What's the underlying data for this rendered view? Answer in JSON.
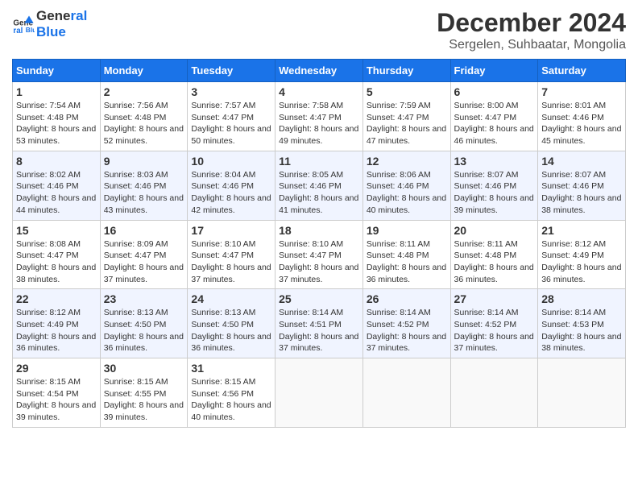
{
  "logo": {
    "line1": "General",
    "line2": "Blue"
  },
  "title": "December 2024",
  "subtitle": "Sergelen, Suhbaatar, Mongolia",
  "headers": [
    "Sunday",
    "Monday",
    "Tuesday",
    "Wednesday",
    "Thursday",
    "Friday",
    "Saturday"
  ],
  "weeks": [
    [
      {
        "day": "1",
        "sunrise": "7:54 AM",
        "sunset": "4:48 PM",
        "daylight": "8 hours and 53 minutes."
      },
      {
        "day": "2",
        "sunrise": "7:56 AM",
        "sunset": "4:48 PM",
        "daylight": "8 hours and 52 minutes."
      },
      {
        "day": "3",
        "sunrise": "7:57 AM",
        "sunset": "4:47 PM",
        "daylight": "8 hours and 50 minutes."
      },
      {
        "day": "4",
        "sunrise": "7:58 AM",
        "sunset": "4:47 PM",
        "daylight": "8 hours and 49 minutes."
      },
      {
        "day": "5",
        "sunrise": "7:59 AM",
        "sunset": "4:47 PM",
        "daylight": "8 hours and 47 minutes."
      },
      {
        "day": "6",
        "sunrise": "8:00 AM",
        "sunset": "4:47 PM",
        "daylight": "8 hours and 46 minutes."
      },
      {
        "day": "7",
        "sunrise": "8:01 AM",
        "sunset": "4:46 PM",
        "daylight": "8 hours and 45 minutes."
      }
    ],
    [
      {
        "day": "8",
        "sunrise": "8:02 AM",
        "sunset": "4:46 PM",
        "daylight": "8 hours and 44 minutes."
      },
      {
        "day": "9",
        "sunrise": "8:03 AM",
        "sunset": "4:46 PM",
        "daylight": "8 hours and 43 minutes."
      },
      {
        "day": "10",
        "sunrise": "8:04 AM",
        "sunset": "4:46 PM",
        "daylight": "8 hours and 42 minutes."
      },
      {
        "day": "11",
        "sunrise": "8:05 AM",
        "sunset": "4:46 PM",
        "daylight": "8 hours and 41 minutes."
      },
      {
        "day": "12",
        "sunrise": "8:06 AM",
        "sunset": "4:46 PM",
        "daylight": "8 hours and 40 minutes."
      },
      {
        "day": "13",
        "sunrise": "8:07 AM",
        "sunset": "4:46 PM",
        "daylight": "8 hours and 39 minutes."
      },
      {
        "day": "14",
        "sunrise": "8:07 AM",
        "sunset": "4:46 PM",
        "daylight": "8 hours and 38 minutes."
      }
    ],
    [
      {
        "day": "15",
        "sunrise": "8:08 AM",
        "sunset": "4:47 PM",
        "daylight": "8 hours and 38 minutes."
      },
      {
        "day": "16",
        "sunrise": "8:09 AM",
        "sunset": "4:47 PM",
        "daylight": "8 hours and 37 minutes."
      },
      {
        "day": "17",
        "sunrise": "8:10 AM",
        "sunset": "4:47 PM",
        "daylight": "8 hours and 37 minutes."
      },
      {
        "day": "18",
        "sunrise": "8:10 AM",
        "sunset": "4:47 PM",
        "daylight": "8 hours and 37 minutes."
      },
      {
        "day": "19",
        "sunrise": "8:11 AM",
        "sunset": "4:48 PM",
        "daylight": "8 hours and 36 minutes."
      },
      {
        "day": "20",
        "sunrise": "8:11 AM",
        "sunset": "4:48 PM",
        "daylight": "8 hours and 36 minutes."
      },
      {
        "day": "21",
        "sunrise": "8:12 AM",
        "sunset": "4:49 PM",
        "daylight": "8 hours and 36 minutes."
      }
    ],
    [
      {
        "day": "22",
        "sunrise": "8:12 AM",
        "sunset": "4:49 PM",
        "daylight": "8 hours and 36 minutes."
      },
      {
        "day": "23",
        "sunrise": "8:13 AM",
        "sunset": "4:50 PM",
        "daylight": "8 hours and 36 minutes."
      },
      {
        "day": "24",
        "sunrise": "8:13 AM",
        "sunset": "4:50 PM",
        "daylight": "8 hours and 36 minutes."
      },
      {
        "day": "25",
        "sunrise": "8:14 AM",
        "sunset": "4:51 PM",
        "daylight": "8 hours and 37 minutes."
      },
      {
        "day": "26",
        "sunrise": "8:14 AM",
        "sunset": "4:52 PM",
        "daylight": "8 hours and 37 minutes."
      },
      {
        "day": "27",
        "sunrise": "8:14 AM",
        "sunset": "4:52 PM",
        "daylight": "8 hours and 37 minutes."
      },
      {
        "day": "28",
        "sunrise": "8:14 AM",
        "sunset": "4:53 PM",
        "daylight": "8 hours and 38 minutes."
      }
    ],
    [
      {
        "day": "29",
        "sunrise": "8:15 AM",
        "sunset": "4:54 PM",
        "daylight": "8 hours and 39 minutes."
      },
      {
        "day": "30",
        "sunrise": "8:15 AM",
        "sunset": "4:55 PM",
        "daylight": "8 hours and 39 minutes."
      },
      {
        "day": "31",
        "sunrise": "8:15 AM",
        "sunset": "4:56 PM",
        "daylight": "8 hours and 40 minutes."
      },
      null,
      null,
      null,
      null
    ]
  ]
}
